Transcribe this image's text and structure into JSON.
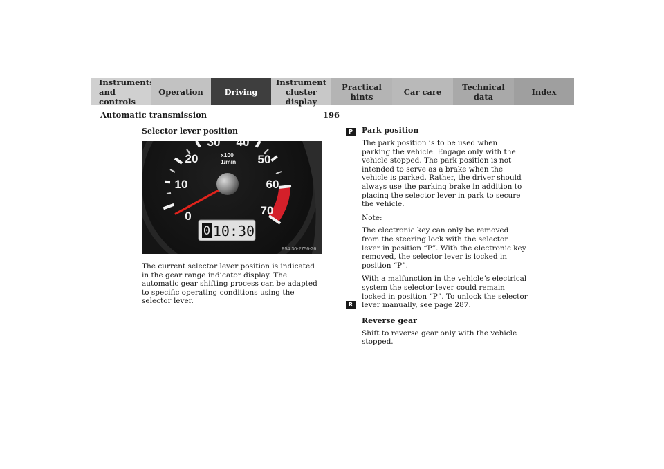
{
  "nav": {
    "tabs": [
      {
        "label_line1": "Instruments",
        "label_line2": "and controls"
      },
      {
        "label_line1": "Operation",
        "label_line2": ""
      },
      {
        "label_line1": "Driving",
        "label_line2": ""
      },
      {
        "label_line1": "Instrument",
        "label_line2": "cluster display"
      },
      {
        "label_line1": "Practical hints",
        "label_line2": ""
      },
      {
        "label_line1": "Car care",
        "label_line2": ""
      },
      {
        "label_line1": "Technical",
        "label_line2": "data"
      },
      {
        "label_line1": "Index",
        "label_line2": ""
      }
    ],
    "active_tab": "Driving"
  },
  "header": {
    "section_title": "Automatic transmission",
    "page_number": "196"
  },
  "left": {
    "heading": "Selector lever position",
    "figure": {
      "ticks": [
        "0",
        "10",
        "20",
        "30",
        "40",
        "50",
        "60",
        "70"
      ],
      "unit_line1": "x100",
      "unit_line2": "1/min",
      "gear_indicator": "0",
      "clock": "10:30",
      "ref": "P54.30-2756-26"
    },
    "paragraph": "The current selector lever position is indicated in the gear range indicator display. The automatic gear shifting process can be adapted to specific operating conditions using the selector lever."
  },
  "right": {
    "park": {
      "marker": "P",
      "heading": "Park position",
      "p1": "The park position is to be used when parking the vehicle. Engage only with the vehicle stopped. The park position is not intended to serve as a brake when the vehicle is parked. Rather, the driver should always use the parking brake in addition to placing the selector lever in park to secure the vehicle.",
      "note_label": "Note:",
      "p2": "The electronic key can only be removed from the steering lock with the selector lever in position “P”. With the electronic key removed, the selector lever is locked in position “P”.",
      "p3": "With a malfunction in the vehicle’s electrical system the selector lever could remain locked in position “P”. To unlock the selector lever manually, see page 287."
    },
    "reverse": {
      "marker": "R",
      "heading": "Reverse gear",
      "p1": "Shift to reverse gear only with the vehicle stopped."
    }
  },
  "colors": {
    "active_tab": "#3e3e3e",
    "redline": "#d4202a",
    "needle": "#e0231c"
  }
}
